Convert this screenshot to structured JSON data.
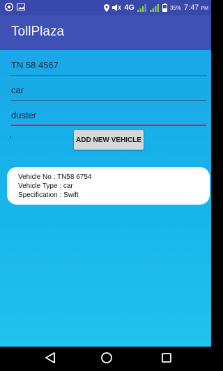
{
  "status_bar": {
    "network": "4G",
    "battery": "35%",
    "time": "7:47",
    "ampm": "PM",
    "icons": [
      "whatsapp-icon",
      "image-icon",
      "location-icon",
      "volume-icon",
      "signal-icon",
      "signal-icon",
      "battery-icon"
    ]
  },
  "app": {
    "title": "TollPlaza",
    "colors": {
      "primary": "#3f51b5",
      "accent": "#d81b60"
    }
  },
  "form": {
    "vehicle_no_value": "TN 58 4567",
    "vehicle_type_value": "car",
    "specification_value": "duster",
    "add_button_label": "ADD NEW VEHICLE"
  },
  "vehicle_list": [
    {
      "vehicle_no": "Vehicle No   : TN58 6754",
      "vehicle_type": "Vehicle Type : car",
      "specification": "Specification : Swift"
    }
  ],
  "nav_bar": {
    "icons": [
      "back-triangle-icon",
      "home-circle-icon",
      "recents-square-icon"
    ]
  }
}
